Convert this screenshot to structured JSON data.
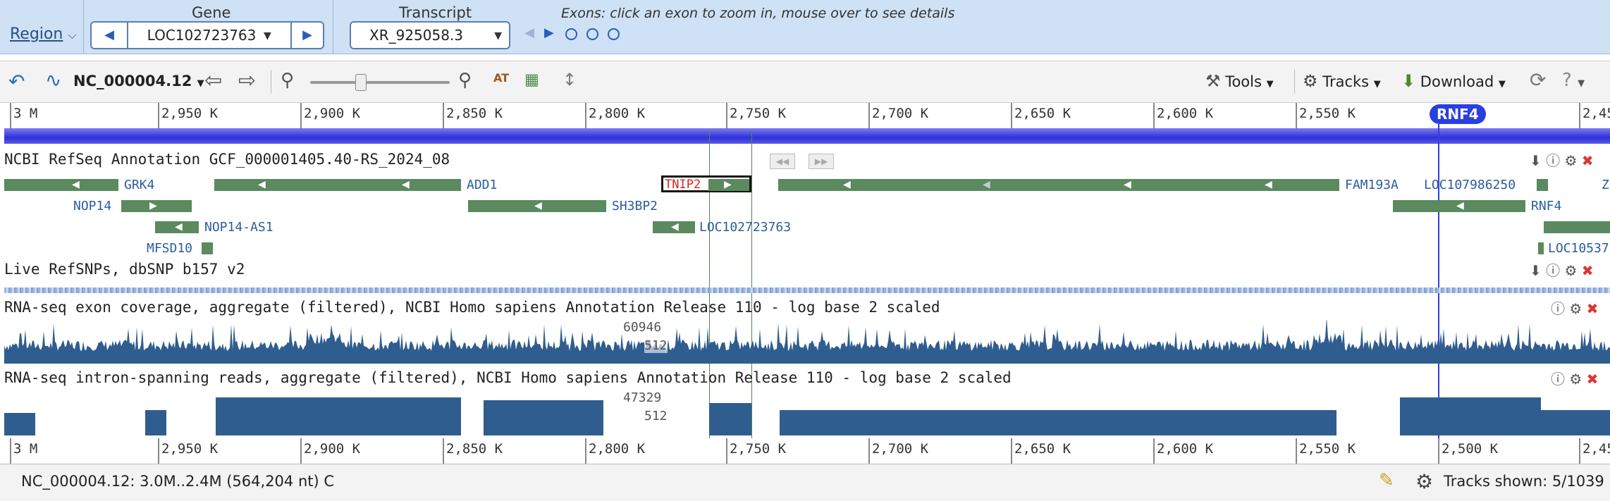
{
  "header": {
    "region_label": "Region",
    "gene_label": "Gene",
    "gene_value": "LOC102723763",
    "transcript_label": "Transcript",
    "transcript_value": "XR_925058.3",
    "exons_hint": "Exons: click an exon to zoom in, mouse over to see details"
  },
  "toolbar": {
    "sequence": "NC_000004.12",
    "tools_label": "Tools",
    "tracks_label": "Tracks",
    "download_label": "Download"
  },
  "ruler_ticks": [
    "3 M",
    "2,950 K",
    "2,900 K",
    "2,850 K",
    "2,800 K",
    "2,750 K",
    "2,700 K",
    "2,650 K",
    "2,600 K",
    "2,550 K"
  ],
  "ruler_top_extra": [
    "K",
    "2,45"
  ],
  "ruler_bottom_ticks": [
    "3 M",
    "2,950 K",
    "2,900 K",
    "2,850 K",
    "2,800 K",
    "2,750 K",
    "2,700 K",
    "2,650 K",
    "2,600 K",
    "2,550 K",
    "2,500 K",
    "2,45"
  ],
  "marker_label": "RNF4",
  "tracks": {
    "annotation_title": "NCBI RefSeq Annotation GCF_000001405.40-RS_2024_08",
    "snp_title": "Live RefSNPs, dbSNP b157 v2",
    "exon_cov_title": "RNA-seq exon coverage, aggregate (filtered), NCBI Homo sapiens Annotation Release 110 - log base 2 scaled",
    "exon_cov_max": "60946",
    "exon_cov_mid": "512",
    "intron_title": "RNA-seq intron-spanning reads, aggregate (filtered), NCBI Homo sapiens Annotation Release 110 - log base 2 scaled",
    "intron_max": "47329",
    "intron_mid": "512"
  },
  "genes": {
    "grk4": "GRK4",
    "add1": "ADD1",
    "tnip2": "TNIP2",
    "fam193a": "FAM193A",
    "loc107986250": "LOC107986250",
    "z": "Z",
    "nop14": "NOP14",
    "sh3bp2": "SH3BP2",
    "rnf4": "RNF4",
    "nop14as1": "NOP14-AS1",
    "loc102723763": "LOC102723763",
    "mfsd10": "MFSD10",
    "loc10537": "LOC10537"
  },
  "status": {
    "location": "NC_000004.12: 3.0M..2.4M (564,204 nt) C",
    "tracks_shown": "Tracks shown: 5/1039"
  },
  "colors": {
    "gene_green": "#5a8a5e",
    "coverage_blue": "#2f5d8f",
    "highlight_red": "#e02020",
    "overview_blue": "#3333dd"
  }
}
